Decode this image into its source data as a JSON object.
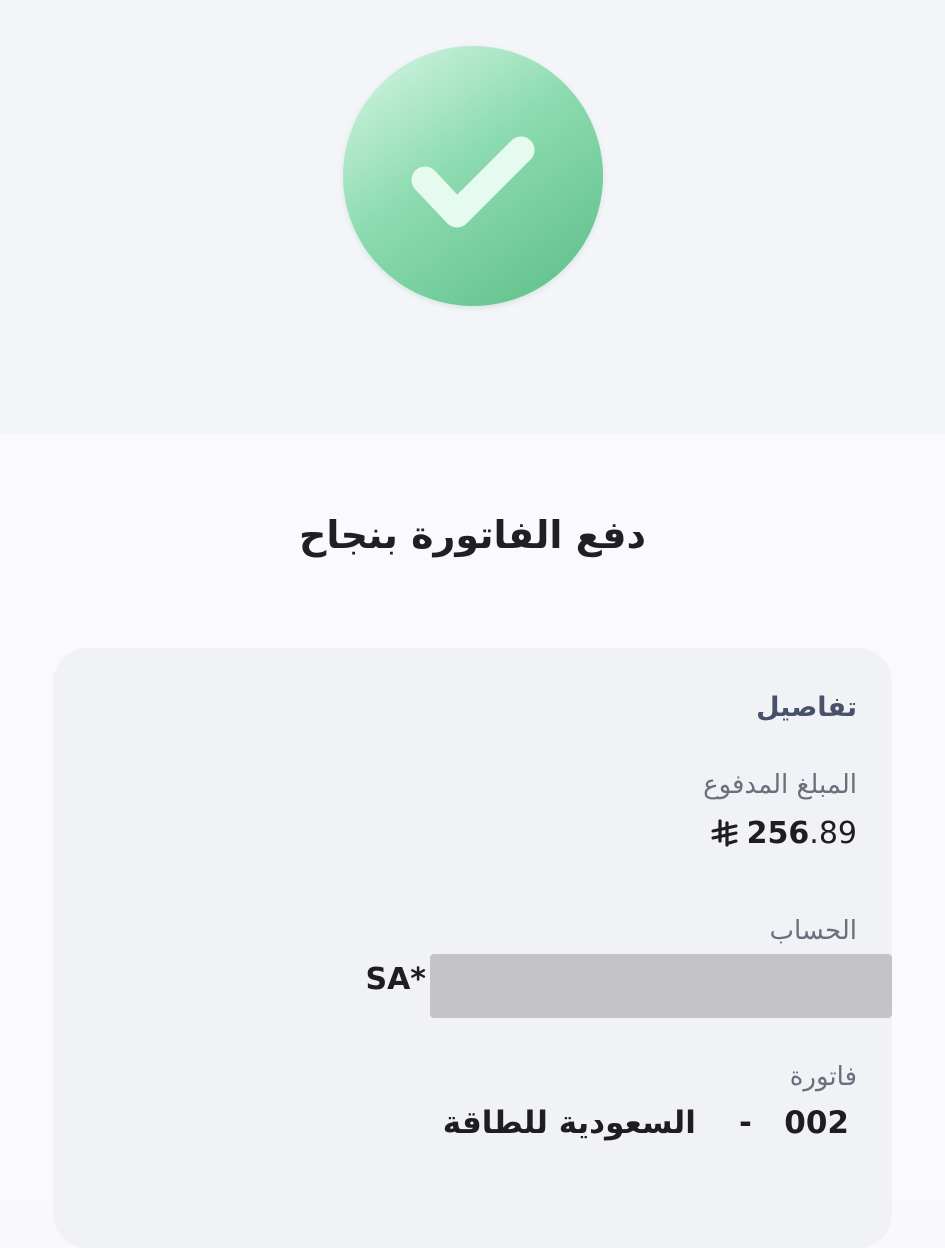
{
  "page_title": "دفع الفاتورة بنجاح",
  "status_icon": "check-icon",
  "colors": {
    "success_green": "#6fcf97",
    "check_mark": "#e6fbef"
  },
  "details": {
    "heading": "تفاصيل",
    "amount": {
      "label": "المبلغ المدفوع",
      "integer_part": "256",
      "decimal_part": ".89",
      "currency_icon": "saudi-riyal-icon"
    },
    "account": {
      "label": "الحساب",
      "prefix": "SA*"
    },
    "bill": {
      "label": "فاتورة",
      "code": "002",
      "separator": "-",
      "name": "السعودية للطاقة"
    }
  }
}
